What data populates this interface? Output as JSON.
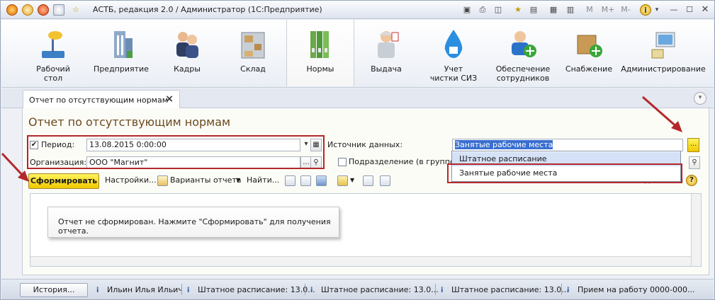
{
  "window": {
    "title": "АСТБ, редакция 2.0 / Администратор  (1С:Предприятие)"
  },
  "titlebar_tools": [
    "save-icon",
    "print-icon",
    "preview-icon",
    "star-icon",
    "history-icon",
    "calc-icon",
    "calendar-icon"
  ],
  "memory": {
    "m": "M",
    "mplus": "M+",
    "mminus": "M-"
  },
  "sections": [
    {
      "label": "Рабочий\nстол",
      "icon": "desk-lamp-icon"
    },
    {
      "label": "Предприятие",
      "icon": "building-icon"
    },
    {
      "label": "Кадры",
      "icon": "people-icon"
    },
    {
      "label": "Склад",
      "icon": "warehouse-icon"
    },
    {
      "label": "Нормы",
      "icon": "binders-icon",
      "active": true
    },
    {
      "label": "Выдача",
      "icon": "worker-icon"
    },
    {
      "label": "Учет\nчистки СИЗ",
      "icon": "water-drop-icon"
    },
    {
      "label": "Обеспечение\nсотрудников",
      "icon": "person-add-icon"
    },
    {
      "label": "Снабжение",
      "icon": "box-add-icon"
    },
    {
      "label": "Администрирование",
      "icon": "computer-icon"
    }
  ],
  "tab": {
    "label": "Отчет по отсутствующим нормам",
    "close": "×"
  },
  "form": {
    "title": "Отчет по отсутствующим нормам",
    "period_label": "Период:",
    "period_value": "13.08.2015  0:00:00",
    "org_label": "Организация:",
    "org_value": "ООО \"Магнит\"",
    "source_label": "Источник данных:",
    "source_value": "Занятые рабочие места",
    "subdivision_label": "Подразделение (в группе):",
    "ellipsis": "..."
  },
  "toolbar": {
    "generate": "Сформировать",
    "settings": "Настройки...",
    "variants": "Варианты отчета",
    "find": "Найти...",
    "all_actions": "Все действия"
  },
  "dropdown": {
    "items": [
      "Штатное расписание",
      "Занятые рабочие места"
    ],
    "selected_index": 0
  },
  "report": {
    "message": "Отчет не сформирован. Нажмите \"Сформировать\" для получения отчета."
  },
  "statusbar": {
    "history": "История...",
    "items": [
      "Ильин Илья Ильич",
      "Штатное расписание: 13.0...",
      "Штатное расписание: 13.0...",
      "Штатное расписание: 13.0...",
      "Прием на работу 0000-000..."
    ]
  },
  "colors": {
    "accent_red": "#b3272a",
    "primary_button": "#f5d400",
    "title_brown": "#6b4a1e"
  }
}
